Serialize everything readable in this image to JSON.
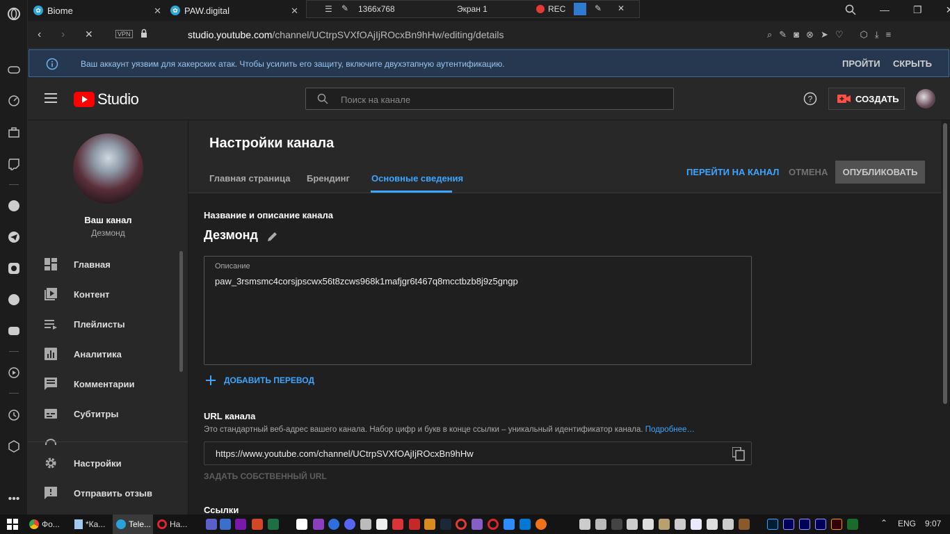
{
  "browser": {
    "tabs": [
      {
        "title": "Biome"
      },
      {
        "title": "PAW.digital"
      }
    ],
    "recorder": {
      "resolution": "1366x768",
      "screen": "Экран 1",
      "rec": "REC"
    },
    "vpn_label": "VPN",
    "url_domain": "studio.youtube.com",
    "url_path": "/channel/UCtrpSVXfOAjIjROcxBn9hHw/editing/details"
  },
  "warning": {
    "text": "Ваш аккаунт уязвим для хакерских атак. Чтобы усилить его защиту, включите двухэтапную аутентификацию.",
    "pass_button": "ПРОЙТИ",
    "hide_button": "СКРЫТЬ"
  },
  "header": {
    "logo_text": "Studio",
    "search_placeholder": "Поиск на канале",
    "create_button": "СОЗДАТЬ"
  },
  "sidebar": {
    "your_channel": "Ваш канал",
    "channel_name": "Дезмонд",
    "items": [
      {
        "label": "Главная",
        "icon": "dashboard-icon"
      },
      {
        "label": "Контент",
        "icon": "content-icon"
      },
      {
        "label": "Плейлисты",
        "icon": "playlists-icon"
      },
      {
        "label": "Аналитика",
        "icon": "analytics-icon"
      },
      {
        "label": "Комментарии",
        "icon": "comments-icon"
      },
      {
        "label": "Субтитры",
        "icon": "subtitles-icon"
      },
      {
        "label": "Настройки",
        "icon": "settings-icon"
      },
      {
        "label": "Отправить отзыв",
        "icon": "feedback-icon"
      }
    ]
  },
  "page": {
    "title": "Настройки канала",
    "tabs": [
      "Главная страница",
      "Брендинг",
      "Основные сведения"
    ],
    "active_tab": "Основные сведения",
    "go_to_channel": "ПЕРЕЙТИ НА КАНАЛ",
    "cancel": "ОТМЕНА",
    "publish": "ОПУБЛИКОВАТЬ"
  },
  "details": {
    "section_title": "Название и описание канала",
    "name": "Дезмонд",
    "description_label": "Описание",
    "description_value": "paw_3rsmsmc4corsjpscwx56t8zcws968k1mafjgr6t467q8mcctbzb8j9z5gngp",
    "add_translation": "ДОБАВИТЬ ПЕРЕВОД",
    "url_title": "URL канала",
    "url_help": "Это стандартный веб-адрес вашего канала. Набор цифр и букв в конце ссылки – уникальный идентификатор канала.",
    "url_more": "Подробнее…",
    "url_value": "https://www.youtube.com/channel/UCtrpSVXfOAjIjROcxBn9hHw",
    "custom_url": "ЗАДАТЬ СОБСТВЕННЫЙ URL",
    "links_title": "Ссылки"
  },
  "taskbar": {
    "apps": [
      {
        "label": "Фо..."
      },
      {
        "label": "*Ка..."
      },
      {
        "label": "Tele..."
      },
      {
        "label": "На..."
      }
    ],
    "lang": "ENG",
    "time": "9:07"
  },
  "colors": {
    "accent": "#3ea6ff",
    "youtube_red": "#ff0000",
    "warning_bg": "#263850"
  }
}
